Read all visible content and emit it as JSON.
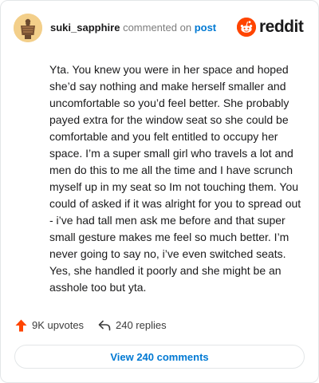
{
  "header": {
    "username": "suki_sapphire",
    "commented_text": "commented on",
    "post_link": "post"
  },
  "logo": {
    "icon": "reddit-alien-icon",
    "text": "reddit"
  },
  "comment": {
    "body": "Yta. You knew you were in her space and hoped she’d say nothing and make herself smaller and uncomfortable so you’d feel better. She probably payed extra for the window seat so she could be comfortable and you felt entitled to occupy her space. I’m a super small girl who travels a lot and men do this to me all the time and I have scrunch myself up in my seat so Im not touching them. You could of asked if it was alright for you to spread out - i’ve had tall men ask me before and that super small gesture makes me feel so much better. I’m never going to say no, i’ve even switched seats. Yes, she handled it poorly and she might be an asshole too but yta."
  },
  "actions": {
    "upvotes": "9K upvotes",
    "upvote_icon": "upvote-arrow-icon",
    "replies": "240 replies",
    "reply_icon": "reply-arrow-icon"
  },
  "footer": {
    "view_comments": "View 240 comments"
  },
  "colors": {
    "accent": "#0079d3",
    "brand": "#ff4500",
    "border": "#e3e6e8",
    "muted": "#7c7c7c"
  }
}
